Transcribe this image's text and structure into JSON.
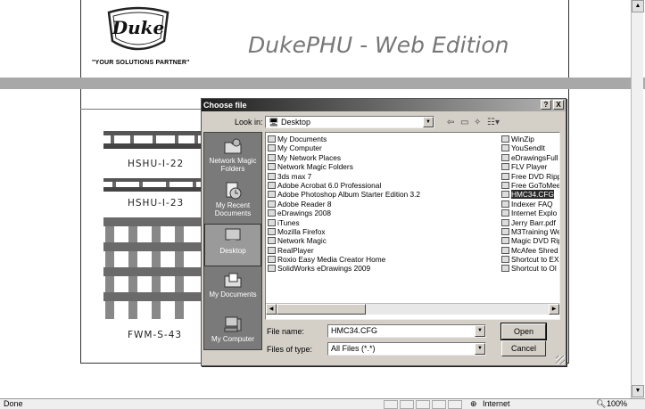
{
  "page": {
    "title": "DukePHU - Web Edition",
    "logo_text": "Duke",
    "slogan": "\"YOUR SOLUTIONS PARTNER\"",
    "products": [
      "HSHU-I-22",
      "HSHU-I-23",
      "FWM-S-43"
    ]
  },
  "statusbar": {
    "status": "Done",
    "zone": "Internet",
    "zoom": "100%"
  },
  "dialog": {
    "title": "Choose file",
    "help": "?",
    "close": "X",
    "look_in_label": "Look in:",
    "look_in_value": "Desktop",
    "places": [
      {
        "label": "Network Magic Folders",
        "icon": "folder-network-icon"
      },
      {
        "label": "My Recent Documents",
        "icon": "recent-documents-icon"
      },
      {
        "label": "Desktop",
        "icon": "desktop-icon"
      },
      {
        "label": "My Documents",
        "icon": "my-documents-icon"
      },
      {
        "label": "My Computer",
        "icon": "my-computer-icon"
      }
    ],
    "files_col1": [
      "My Documents",
      "My Computer",
      "My Network Places",
      "Network Magic Folders",
      "3ds max 7",
      "Adobe Acrobat 6.0 Professional",
      "Adobe Photoshop Album Starter Edition 3.2",
      "Adobe Reader 8",
      "eDrawings 2008",
      "iTunes",
      "Mozilla Firefox",
      "Network Magic",
      "RealPlayer",
      "Roxio Easy Media Creator Home",
      "SolidWorks eDrawings 2009"
    ],
    "files_col2": [
      "WinZip",
      "YouSendIt",
      "eDrawingsFull",
      "FLV Player",
      "Free DVD Ripp",
      "Free GoToMee",
      "HMC34.CFG",
      "Indexer FAQ",
      "Internet Explo",
      "Jerry Barr.pdf",
      "M3Training We",
      "Magic DVD Rip",
      "McAfee Shred",
      "Shortcut to EX",
      "Shortcut to Ol"
    ],
    "selected_file": "HMC34.CFG",
    "file_name_label": "File name:",
    "file_name_value": "HMC34.CFG",
    "file_type_label": "Files of type:",
    "file_type_value": "All Files (*.*)",
    "open_label": "Open",
    "cancel_label": "Cancel"
  }
}
